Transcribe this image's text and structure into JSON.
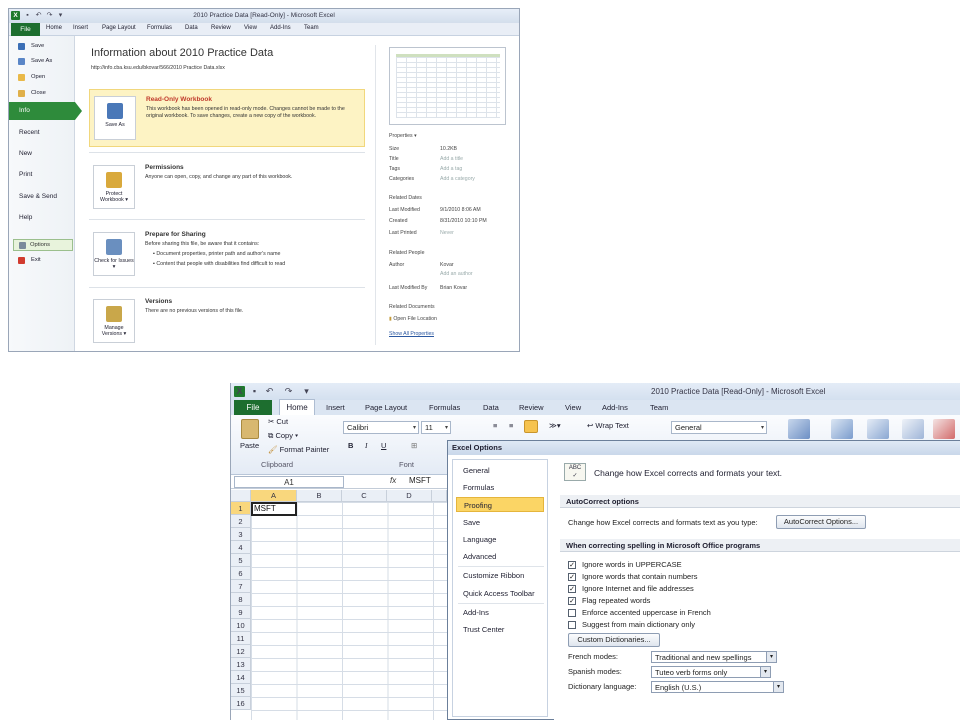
{
  "win1": {
    "title": "2010 Practice Data  [Read-Only]  -  Microsoft Excel",
    "tabs": [
      "File",
      "Home",
      "Insert",
      "Page Layout",
      "Formulas",
      "Data",
      "Review",
      "View",
      "Add-Ins",
      "Team"
    ],
    "menu_small": [
      "Save",
      "Save As",
      "Open",
      "Close"
    ],
    "nav": [
      "Info",
      "Recent",
      "New",
      "Print",
      "Save & Send",
      "Help"
    ],
    "options": "Options",
    "exit": "Exit",
    "heading": "Information about 2010 Practice Data",
    "url": "http://info.cba.ksu.edu/bkovar/566/2010 Practice Data.xlsx",
    "sections": {
      "readonly": {
        "btn": "Save As",
        "title": "Read-Only Workbook",
        "desc": "This workbook has been opened in read-only mode. Changes cannot be made to the original workbook. To save changes, create a new copy of the workbook."
      },
      "permissions": {
        "btn": "Protect Workbook ▾",
        "title": "Permissions",
        "desc": "Anyone can open, copy, and change any part of this workbook."
      },
      "sharing": {
        "btn": "Check for Issues ▾",
        "title": "Prepare for Sharing",
        "desc": "Before sharing this file, be aware that it contains:",
        "b1": "Document properties, printer path and author's name",
        "b2": "Content that people with disabilities find difficult to read"
      },
      "versions": {
        "btn": "Manage Versions ▾",
        "title": "Versions",
        "desc": "There are no previous versions of this file."
      }
    },
    "props": {
      "header": "Properties ▾",
      "size_l": "Size",
      "size_v": "10.2KB",
      "title_l": "Title",
      "title_v": "Add a title",
      "tags_l": "Tags",
      "tags_v": "Add a tag",
      "cat_l": "Categories",
      "cat_v": "Add a category",
      "dates_h": "Related Dates",
      "mod_l": "Last Modified",
      "mod_v": "9/1/2010 8:06 AM",
      "cre_l": "Created",
      "cre_v": "8/31/2010 10:10 PM",
      "prn_l": "Last Printed",
      "prn_v": "Never",
      "people_h": "Related People",
      "auth_l": "Author",
      "auth_v": "Kovar",
      "auth_add": "Add an author",
      "modby_l": "Last Modified By",
      "modby_v": "Brian Kovar",
      "docs_h": "Related Documents",
      "openloc": "Open File Location",
      "showall": "Show All Properties"
    }
  },
  "win2": {
    "title": "2010 Practice Data  [Read-Only]  -  Microsoft Excel",
    "tabs": [
      "File",
      "Home",
      "Insert",
      "Page Layout",
      "Formulas",
      "Data",
      "Review",
      "View",
      "Add-Ins",
      "Team"
    ],
    "clipboard": {
      "paste": "Paste",
      "cut": "Cut",
      "copy": "Copy ▾",
      "painter": "Format Painter",
      "label": "Clipboard"
    },
    "font": {
      "name": "Calibri",
      "size": "11",
      "label": "Font"
    },
    "wrap": "Wrap Text",
    "numfmt": "General",
    "namebox": "A1",
    "fx": "fx",
    "formula": "MSFT",
    "columns": [
      "A",
      "B",
      "C",
      "D"
    ],
    "rows": [
      "1",
      "2",
      "3",
      "4",
      "5",
      "6",
      "7",
      "8",
      "9",
      "10",
      "11",
      "12",
      "13",
      "14",
      "15",
      "16"
    ],
    "a1": "MSFT",
    "dialog": {
      "title": "Excel Options",
      "nav": [
        "General",
        "Formulas",
        "Proofing",
        "Save",
        "Language",
        "Advanced",
        "Customize Ribbon",
        "Quick Access Toolbar",
        "Add-Ins",
        "Trust Center"
      ],
      "header": "Change how Excel corrects and formats your text.",
      "autocorrect_h": "AutoCorrect options",
      "autocorrect_l": "Change how Excel corrects and formats text as you type:",
      "autocorrect_btn": "AutoCorrect Options...",
      "spelling_h": "When correcting spelling in Microsoft Office programs",
      "checks": [
        {
          "label": "Ignore words in UPPERCASE",
          "checked": "✓"
        },
        {
          "label": "Ignore words that contain numbers",
          "checked": "✓"
        },
        {
          "label": "Ignore Internet and file addresses",
          "checked": "✓"
        },
        {
          "label": "Flag repeated words",
          "checked": "✓"
        },
        {
          "label": "Enforce accented uppercase in French",
          "checked": ""
        },
        {
          "label": "Suggest from main dictionary only",
          "checked": ""
        }
      ],
      "custom_btn": "Custom Dictionaries...",
      "french_l": "French modes:",
      "french_v": "Traditional and new spellings",
      "spanish_l": "Spanish modes:",
      "spanish_v": "Tuteo verb forms only",
      "dict_l": "Dictionary language:",
      "dict_v": "English (U.S.)"
    }
  },
  "colors": {
    "file_green": "#1d6e2f",
    "info_green": "#2e8b3b",
    "highlight": "#fbd565",
    "readonly_bg": "#fdf3c4"
  }
}
